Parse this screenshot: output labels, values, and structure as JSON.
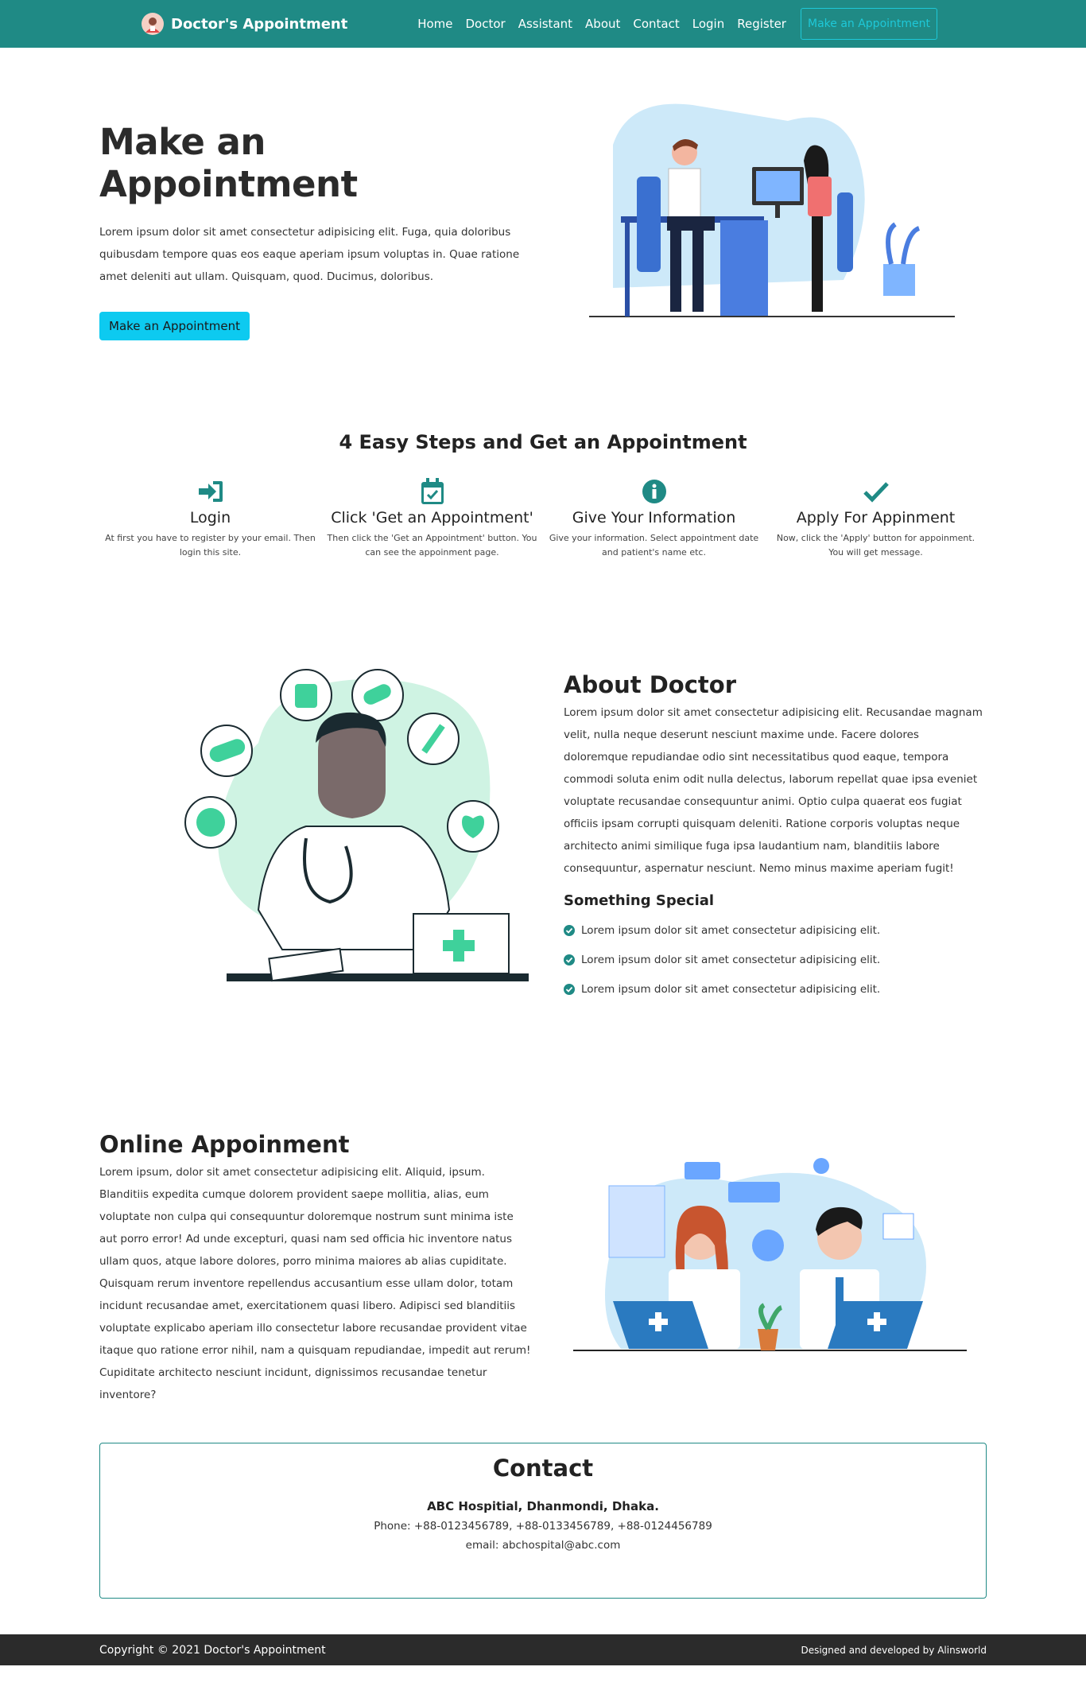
{
  "nav": {
    "brand": "Doctor's Appointment",
    "links": [
      "Home",
      "Doctor",
      "Assistant",
      "About",
      "Contact",
      "Login",
      "Register"
    ],
    "cta": "Make an Appointment"
  },
  "hero": {
    "title": "Make an Appointment",
    "description": "Lorem ipsum dolor sit amet consectetur adipisicing elit. Fuga, quia doloribus quibusdam tempore quas eos eaque aperiam ipsum voluptas in. Quae ratione amet deleniti aut ullam. Quisquam, quod. Ducimus, doloribus.",
    "button": "Make an Appointment"
  },
  "steps": {
    "title": "4 Easy Steps and Get an Appointment",
    "items": [
      {
        "icon": "sign-in-icon",
        "title": "Login",
        "desc": "At first you have to register by your email. Then login this site."
      },
      {
        "icon": "calendar-check-icon",
        "title": "Click 'Get an Appointment'",
        "desc": "Then click the 'Get an Appointment' button. You can see the appoinment page."
      },
      {
        "icon": "info-icon",
        "title": "Give Your Information",
        "desc": "Give your information. Select appointment date and patient's name etc."
      },
      {
        "icon": "check-icon",
        "title": "Apply For Appinment",
        "desc": "Now, click the 'Apply' button for appoinment. You will get message."
      }
    ]
  },
  "about": {
    "title": "About Doctor",
    "text": "Lorem ipsum dolor sit amet consectetur adipisicing elit. Recusandae magnam velit, nulla neque deserunt nesciunt maxime unde. Facere dolores doloremque repudiandae odio sint necessitatibus quod eaque, tempora commodi soluta enim odit nulla delectus, laborum repellat quae ipsa eveniet voluptate recusandae consequuntur animi. Optio culpa quaerat eos fugiat officiis ipsam corrupti quisquam deleniti. Ratione corporis voluptas neque architecto animi similique fuga ipsa laudantium nam, blanditiis labore consequuntur, aspernatur nesciunt. Nemo minus maxime aperiam fugit!",
    "special_title": "Something Special",
    "special_items": [
      "Lorem ipsum dolor sit amet consectetur adipisicing elit.",
      "Lorem ipsum dolor sit amet consectetur adipisicing elit.",
      "Lorem ipsum dolor sit amet consectetur adipisicing elit."
    ]
  },
  "online": {
    "title": "Online Appoinment",
    "text": "Lorem ipsum, dolor sit amet consectetur adipisicing elit. Aliquid, ipsum. Blanditiis expedita cumque dolorem provident saepe mollitia, alias, eum voluptate non culpa qui consequuntur doloremque nostrum sunt minima iste aut porro error! Ad unde excepturi, quasi nam sed officia hic inventore natus ullam quos, atque labore dolores, porro minima maiores ab alias cupiditate. Quisquam rerum inventore repellendus accusantium esse ullam dolor, totam incidunt recusandae amet, exercitationem quasi libero. Adipisci sed blanditiis voluptate explicabo aperiam illo consectetur labore recusandae provident vitae itaque quo ratione error nihil, nam a quisquam repudiandae, impedit aut rerum! Cupiditate architecto nesciunt incidunt, dignissimos recusandae tenetur inventore?"
  },
  "contact": {
    "title": "Contact",
    "name": "ABC Hospitial, Dhanmondi, Dhaka.",
    "phone": "Phone: +88-0123456789, +88-0133456789, +88-0124456789",
    "email": "email: abchospital@abc.com"
  },
  "footer": {
    "copyright": "Copyright © 2021 Doctor's Appointment",
    "credit": "Designed and developed by Alinsworld"
  },
  "colors": {
    "primary": "#1f8a85",
    "accent": "#0dcaf0",
    "footer": "#2b2b2b"
  }
}
